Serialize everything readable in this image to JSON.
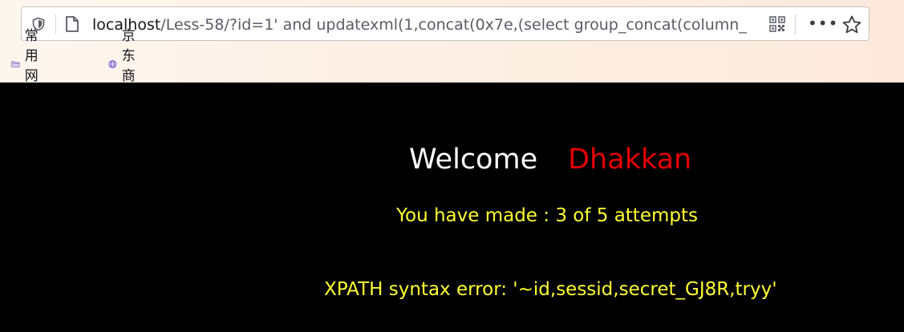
{
  "browser": {
    "url_host": "localhost",
    "url_path": "/Less-58/?id=1' and updatexml(1,concat(0x7e,(select group_concat(column_",
    "bookmarks": [
      {
        "label": "常用网址",
        "icon": "folder-icon"
      },
      {
        "label": "京东商城",
        "icon": "globe-icon"
      }
    ],
    "more_label": "•••"
  },
  "page": {
    "welcome": "Welcome",
    "name": "Dhakkan",
    "attempts": "You have made : 3 of 5 attempts",
    "error": "XPATH syntax error: '~id,sessid,secret_GJ8R,tryy'"
  },
  "colors": {
    "background": "#000000",
    "welcome": "#ffffff",
    "name": "#e60000",
    "message": "#ffff33"
  }
}
